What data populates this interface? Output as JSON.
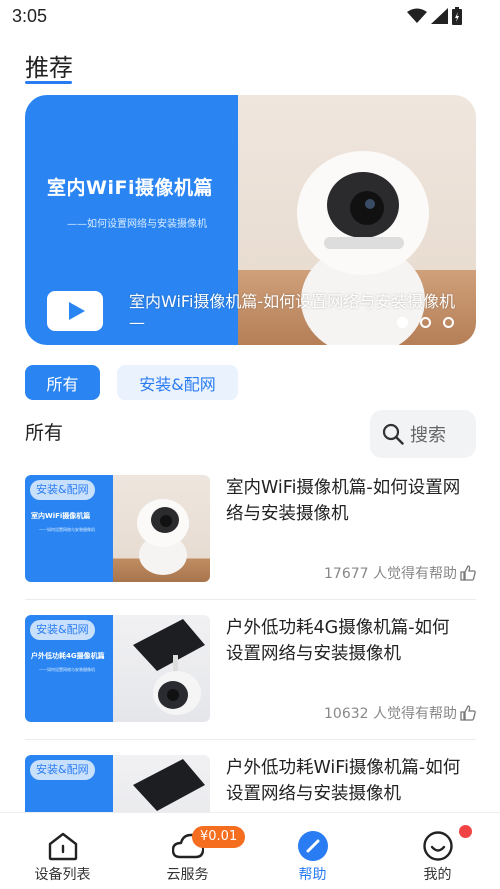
{
  "status_bar": {
    "time": "3:05"
  },
  "recommend": {
    "title": "推荐",
    "banner": {
      "headline": "室内WiFi摄像机篇",
      "subline": "——如何设置网络与安装摄像机",
      "caption": "室内WiFi摄像机篇-如何设置网络与安装摄像机 —",
      "slide_count": 3,
      "active_slide": 1
    }
  },
  "filters": {
    "all": "所有",
    "install": "安装&配网"
  },
  "list": {
    "heading": "所有",
    "search_label": "搜索"
  },
  "articles": [
    {
      "tag": "安装&配网",
      "thumb_title": "室内WiFi摄像机篇",
      "thumb_sub": "——如何设置网络与安装摄像机",
      "title": "室内WiFi摄像机篇-如何设置网络与安装摄像机",
      "helpful": "17677 人觉得有帮助"
    },
    {
      "tag": "安装&配网",
      "thumb_title": "户外低功耗4G摄像机篇",
      "thumb_sub": "——如何设置网络与安装摄像机",
      "title": "户外低功耗4G摄像机篇-如何设置网络与安装摄像机",
      "helpful": "10632 人觉得有帮助"
    },
    {
      "tag": "安装&配网",
      "title": "户外低功耗WiFi摄像机篇-如何设置网络与安装摄像机"
    }
  ],
  "tab_bar": {
    "tabs": [
      {
        "label": "设备列表",
        "icon": "home-icon"
      },
      {
        "label": "云服务",
        "icon": "cloud-icon"
      },
      {
        "label": "帮助",
        "icon": "help-icon"
      },
      {
        "label": "我的",
        "icon": "smiley-icon"
      }
    ],
    "active_tab": "帮助",
    "promo_badge": "¥0.01"
  },
  "colors": {
    "accent": "#2a7cf2",
    "banner_blue": "#2a85f2",
    "badge_orange": "#f56d1f",
    "notify_red": "#f04444"
  }
}
